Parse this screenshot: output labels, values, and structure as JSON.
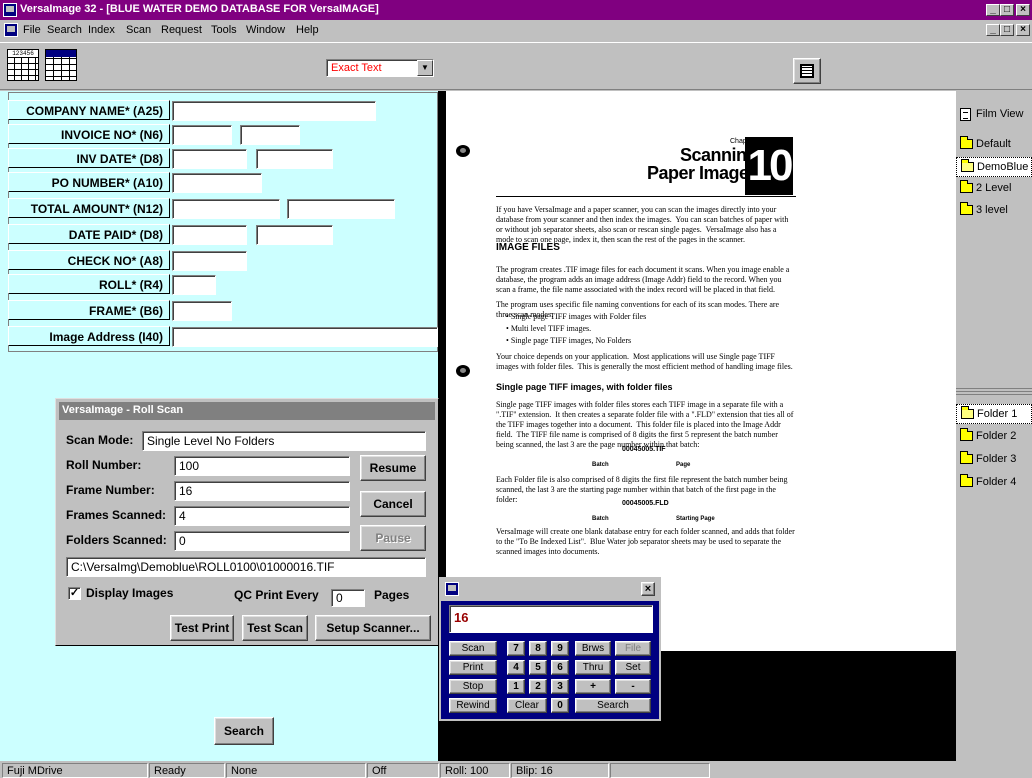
{
  "window": {
    "title": "VersaImage 32 - [BLUE WATER DEMO DATABASE FOR VersaIMAGE]",
    "controls": [
      "_",
      "7",
      "x"
    ]
  },
  "menu": [
    "File",
    "Search",
    "Index",
    "Scan",
    "Request",
    "Tools",
    "Window",
    "Help"
  ],
  "toolbar": {
    "icon1_text": "123456",
    "search_mode": "Exact Text",
    "dropdown_arrow": "▼"
  },
  "fields": [
    {
      "label": "COMPANY NAME* (A25)"
    },
    {
      "label": "INVOICE NO* (N6)"
    },
    {
      "label": "INV DATE* (D8)"
    },
    {
      "label": "PO NUMBER* (A10)"
    },
    {
      "label": "TOTAL AMOUNT* (N12)"
    },
    {
      "label": "DATE PAID* (D8)"
    },
    {
      "label": "CHECK NO* (A8)"
    },
    {
      "label": "ROLL* (R4)"
    },
    {
      "label": "FRAME* (B6)"
    },
    {
      "label": "Image Address (I40)"
    }
  ],
  "search_button": "Search",
  "rollscan": {
    "caption": "VersaImage - Roll Scan",
    "scan_mode_label": "Scan Mode:",
    "scan_mode_value": "Single Level No Folders",
    "roll_label": "Roll Number:",
    "roll_value": "100",
    "frame_label": "Frame Number:",
    "frame_value": "16",
    "frames_scanned_label": "Frames Scanned:",
    "frames_scanned_value": "4",
    "folders_scanned_label": "Folders Scanned:",
    "folders_scanned_value": "0",
    "path": "C:\\VersaImg\\Demoblue\\ROLL0100\\01000016.TIF",
    "display_images_label": "Display Images",
    "display_images_checked": "✓",
    "qc_label": "QC Print Every",
    "qc_value": "0",
    "pages_label": "Pages",
    "resume": "Resume",
    "cancel": "Cancel",
    "pause": "Pause",
    "test_print": "Test Print",
    "test_scan": "Test Scan",
    "setup_scanner": "Setup Scanner..."
  },
  "document": {
    "chapter": "Chapter Ten",
    "title_line1": "Scanning",
    "title_line2": "Paper Images",
    "chapter_number": "10",
    "para1": "If you have VersaImage and a paper scanner, you can scan the images directly into your database from your scanner and then index the images.  You can scan batches of paper with or without job separator sheets, also scan or rescan single pages.  VersaImage also has a mode to scan one page, index it, then scan the rest of the pages in the scanner.",
    "heading1": "IMAGE FILES",
    "para2": "The program creates .TIF image files for each document it scans. When you image enable a database, the program adds an image address (Image Addr) field to the record. When you scan a frame, the file name associated with the index record will be placed in that field.",
    "para3": "The program uses specific file naming conventions for each of its scan modes. There are three scan modes:",
    "bullets": [
      "Single page TIFF images with Folder files",
      "Multi level TIFF images.",
      "Single page TIFF images, No Folders"
    ],
    "para4": "Your choice depends on your application.  Most applications will use Single page TIFF images with folder files.  This is generally the most efficient method of handling image files.",
    "heading2": "Single page TIFF images, with folder files",
    "para5": "Single page TIFF images with folder files stores each TIFF image in a separate file with a \".TIF\" extension.  It then creates a separate folder file with a \".FLD\" extension that ties all of the TIFF images together into a document.  This folder file is placed into the Image Addr field.  The TIFF file name is comprised of 8 digits the first 5 represent the batch number being scanned, the last 3 are the page number within that batch:",
    "diagram1_file": "00045005.TIF",
    "diagram1_left": "Batch",
    "diagram1_right": "Page",
    "para6": "Each Folder file is also comprised of 8 digits the first file represent the batch number being scanned, the last 3 are the starting page number within that batch of the first page in the folder:",
    "diagram2_file": "00045005.FLD",
    "diagram2_left": "Batch",
    "diagram2_right": "Starting Page",
    "para7": "VersaImage will create one blank database entry for each folder scanned, and adds that folder to the \"To Be Indexed List\".  Blue Water job separator sheets may be used to separate the scanned images into documents."
  },
  "keypad": {
    "display": "16",
    "close": "×",
    "buttons": {
      "scan": "Scan",
      "print": "Print",
      "stop": "Stop",
      "rewind": "Rewind",
      "k7": "7",
      "k8": "8",
      "k9": "9",
      "k4": "4",
      "k5": "5",
      "k6": "6",
      "k1": "1",
      "k2": "2",
      "k3": "3",
      "k0": "0",
      "clear": "Clear",
      "brws": "Brws",
      "file": "File",
      "thru": "Thru",
      "set": "Set",
      "plus": "+",
      "minus": "-",
      "search": "Search"
    }
  },
  "rightpane": {
    "film_view": "Film View",
    "levels": [
      "Default",
      "DemoBlue",
      "2 Level",
      "3 level"
    ],
    "folders": [
      "Folder 1",
      "Folder 2",
      "Folder 3",
      "Folder 4"
    ]
  },
  "statusbar": [
    "Fuji MDrive",
    "Ready",
    "None",
    "Off",
    "Roll: 100",
    "Blip: 16",
    ""
  ]
}
